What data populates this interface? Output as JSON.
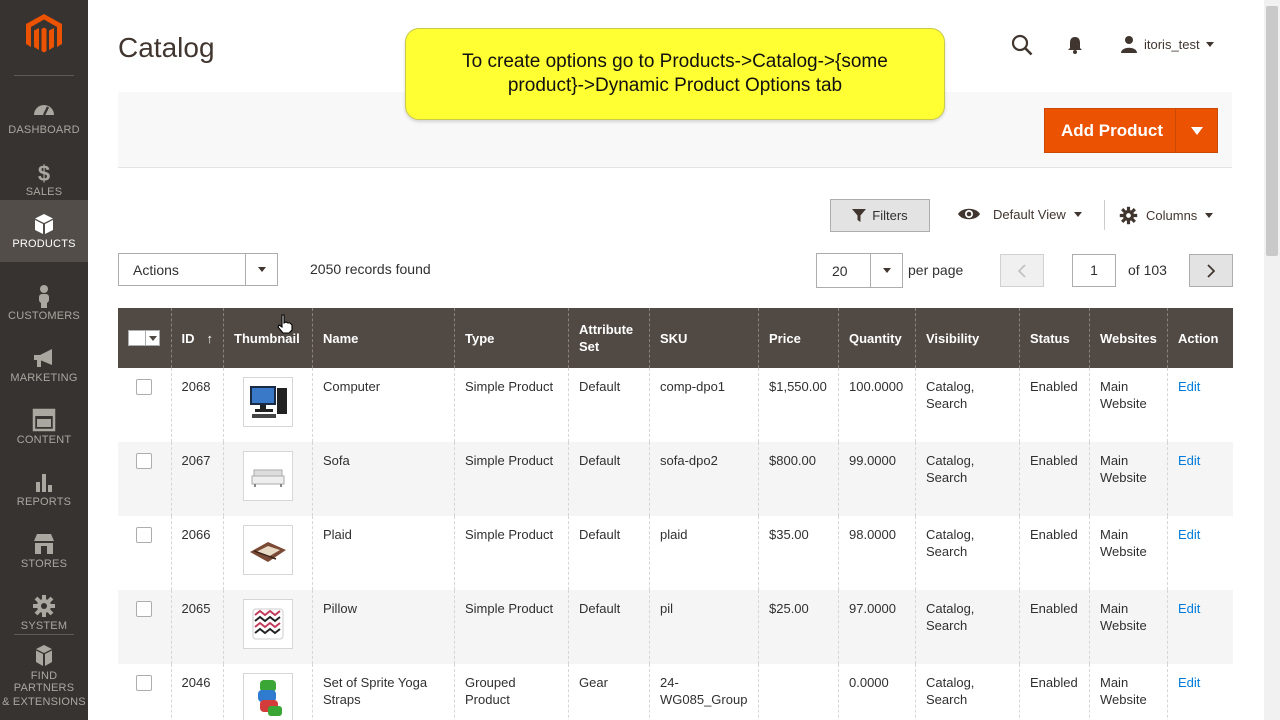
{
  "sidebar": {
    "items": [
      {
        "label": "DASHBOARD",
        "icon": "dashboard-icon"
      },
      {
        "label": "SALES",
        "icon": "dollar-icon"
      },
      {
        "label": "PRODUCTS",
        "icon": "box-icon",
        "active": true
      },
      {
        "label": "CUSTOMERS",
        "icon": "person-icon"
      },
      {
        "label": "MARKETING",
        "icon": "megaphone-icon"
      },
      {
        "label": "CONTENT",
        "icon": "layout-icon"
      },
      {
        "label": "REPORTS",
        "icon": "bar-chart-icon"
      },
      {
        "label": "STORES",
        "icon": "store-icon"
      },
      {
        "label": "SYSTEM",
        "icon": "gear-icon"
      },
      {
        "label_line1": "FIND PARTNERS",
        "label_line2": "& EXTENSIONS",
        "icon": "cubes-icon"
      }
    ]
  },
  "header": {
    "title": "Catalog",
    "username": "itoris_test"
  },
  "callout": {
    "line1": "To create options go to Products->Catalog->{some",
    "line2": "product}->Dynamic Product Options tab"
  },
  "toolbar": {
    "add_product_label": "Add Product"
  },
  "grid_controls": {
    "filters_label": "Filters",
    "view_label": "Default View",
    "columns_label": "Columns",
    "actions_label": "Actions",
    "records_found": "2050 records found",
    "per_page_value": "20",
    "per_page_label": "per page",
    "current_page": "1",
    "total_pages_label": "of 103"
  },
  "table": {
    "columns": [
      "ID",
      "Thumbnail",
      "Name",
      "Type",
      "Attribute Set",
      "SKU",
      "Price",
      "Quantity",
      "Visibility",
      "Status",
      "Websites",
      "Action"
    ],
    "sort_indicator": "↑",
    "rows": [
      {
        "id": "2068",
        "name": "Computer",
        "type": "Simple Product",
        "attribute_set": "Default",
        "sku": "comp-dpo1",
        "price": "$1,550.00",
        "quantity": "100.0000",
        "visibility": "Catalog, Search",
        "status": "Enabled",
        "websites": "Main Website",
        "action": "Edit",
        "thumb": "computer"
      },
      {
        "id": "2067",
        "name": "Sofa",
        "type": "Simple Product",
        "attribute_set": "Default",
        "sku": "sofa-dpo2",
        "price": "$800.00",
        "quantity": "99.0000",
        "visibility": "Catalog, Search",
        "status": "Enabled",
        "websites": "Main Website",
        "action": "Edit",
        "thumb": "sofa"
      },
      {
        "id": "2066",
        "name": "Plaid",
        "type": "Simple Product",
        "attribute_set": "Default",
        "sku": "plaid",
        "price": "$35.00",
        "quantity": "98.0000",
        "visibility": "Catalog, Search",
        "status": "Enabled",
        "websites": "Main Website",
        "action": "Edit",
        "thumb": "plaid"
      },
      {
        "id": "2065",
        "name": "Pillow",
        "type": "Simple Product",
        "attribute_set": "Default",
        "sku": "pil",
        "price": "$25.00",
        "quantity": "97.0000",
        "visibility": "Catalog, Search",
        "status": "Enabled",
        "websites": "Main Website",
        "action": "Edit",
        "thumb": "pillow"
      },
      {
        "id": "2046",
        "name": "Set of Sprite Yoga Straps",
        "type": "Grouped Product",
        "attribute_set": "Gear",
        "sku": "24-WG085_Group",
        "price": "",
        "quantity": "0.0000",
        "visibility": "Catalog, Search",
        "status": "Enabled",
        "websites": "Main Website",
        "action": "Edit",
        "thumb": "straps"
      }
    ]
  },
  "colors": {
    "sidebar_bg": "#373330",
    "sidebar_active": "#524d49",
    "accent": "#eb5202",
    "table_header": "#514943",
    "callout": "#ffff33",
    "link": "#007bdb"
  }
}
